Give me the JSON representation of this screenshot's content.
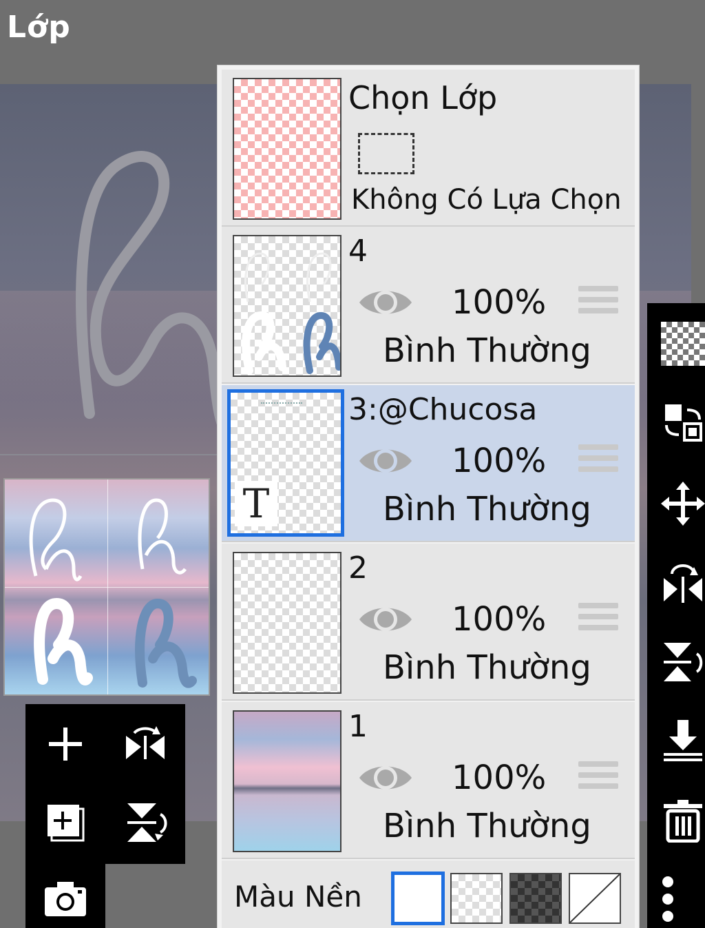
{
  "app": {
    "title": "Lớp"
  },
  "selection_layer": {
    "title": "Chọn Lớp",
    "status": "Không Có Lựa Chọn"
  },
  "layers": [
    {
      "name": "4",
      "opacity": "100%",
      "blend_mode": "Bình Thường",
      "visible": true,
      "selected": false
    },
    {
      "name": "3:@Chucosa",
      "opacity": "100%",
      "blend_mode": "Bình Thường",
      "visible": true,
      "selected": true,
      "type_badge": "T"
    },
    {
      "name": "2",
      "opacity": "100%",
      "blend_mode": "Bình Thường",
      "visible": true,
      "selected": false
    },
    {
      "name": "1",
      "opacity": "100%",
      "blend_mode": "Bình Thường",
      "visible": true,
      "selected": false
    }
  ],
  "background_color": {
    "label": "Màu Nền",
    "options": [
      "white",
      "transparent",
      "dark-checker",
      "none"
    ],
    "selected": "white"
  },
  "left_toolbox": [
    "add-layer-icon",
    "flip-horizontal-icon",
    "add-layer-copy-icon",
    "flip-vertical-icon",
    "camera-icon"
  ],
  "right_toolbar": [
    "transparency-icon",
    "swap-layers-icon",
    "move-icon",
    "flip-horizontal-icon",
    "flip-vertical-icon",
    "merge-down-icon",
    "trash-icon",
    "more-icon"
  ],
  "colors": {
    "selected_row": "#cad6ea",
    "selected_border": "#1e6fe0",
    "row": "#e6e6e6"
  }
}
